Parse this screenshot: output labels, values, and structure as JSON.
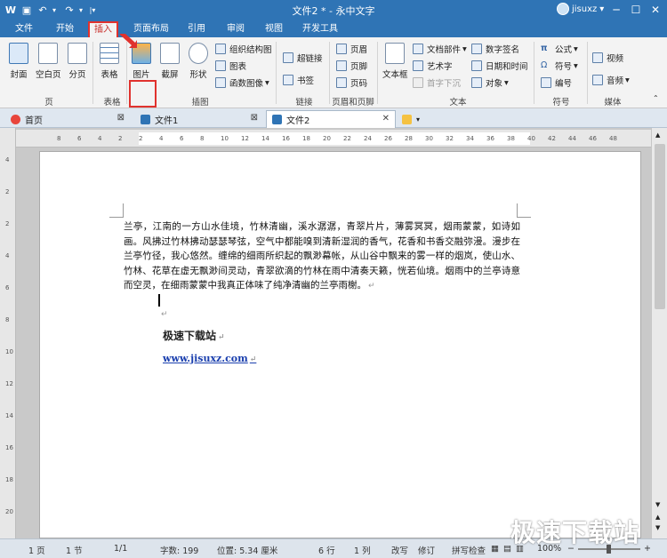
{
  "titlebar": {
    "title": "文件2 * - 永中文字",
    "username": "jisuxz"
  },
  "menu": [
    "文件",
    "开始",
    "插入",
    "页面布局",
    "引用",
    "审阅",
    "视图",
    "开发工具"
  ],
  "ribbon": {
    "page_group": {
      "cover": "封面",
      "blank": "空白页",
      "break": "分页",
      "label": "页"
    },
    "table_group": {
      "table": "表格",
      "label": "表格"
    },
    "illustration_group": {
      "picture": "图片",
      "screenshot": "截屏",
      "shape": "形状",
      "smartart": "组织结构图",
      "chart": "图表",
      "function": "函数图像",
      "label": "插图"
    },
    "link_group": {
      "hyperlink": "超链接",
      "bookmark": "书签",
      "label": "链接"
    },
    "header_group": {
      "header": "页眉",
      "footer": "页脚",
      "page_number": "页码",
      "label": "页眉和页脚"
    },
    "text_group": {
      "textbox": "文本框",
      "doc_parts": "文档部件",
      "art_text": "艺术字",
      "dropcap": "首字下沉",
      "digital_sig": "数字签名",
      "datetime": "日期和时间",
      "object": "对象",
      "label": "文本"
    },
    "symbol_group": {
      "formula": "公式",
      "symbol": "符号",
      "numbering": "编号",
      "label": "符号"
    },
    "media_group": {
      "video": "视频",
      "audio": "音频",
      "label": "媒体"
    }
  },
  "tabs": [
    {
      "label": "首页"
    },
    {
      "label": "文件1"
    },
    {
      "label": "文件2"
    }
  ],
  "ruler_numbers_h": [
    "8",
    "6",
    "4",
    "2",
    "2",
    "4",
    "6",
    "8",
    "10",
    "12",
    "14",
    "16",
    "18",
    "20",
    "22",
    "24",
    "26",
    "28",
    "30",
    "32",
    "34",
    "36",
    "38",
    "40",
    "42",
    "44",
    "46",
    "48"
  ],
  "ruler_numbers_v": [
    "4",
    "2",
    "2",
    "4",
    "6",
    "8",
    "10",
    "12",
    "14",
    "16",
    "18",
    "20"
  ],
  "document": {
    "paragraph": "兰亭，江南的一方山水佳境，竹林清幽，溪水潺潺，青翠片片，薄雾冥冥，烟雨蒙蒙，如诗如画。风拂过竹林拂动瑟瑟琴弦，空气中都能嗅到清新湿润的香气，花香和书香交融弥漫。漫步在兰亭竹径，我心悠然。缠绵的细雨所织起的飘渺幕帐，从山谷中飘来的雾一样的烟岚，使山水、竹林、花草在虚无飘渺间灵动，青翠欲滴的竹林在雨中清奏天籁，恍若仙境。烟雨中的兰亭诗意而空灵，在细雨蒙蒙中我真正体味了纯净清幽的兰亭雨榭。",
    "bold_line": "极速下载站",
    "link": "www.jisuxz.com",
    "para_mark": "↵"
  },
  "status": {
    "page": "1 页",
    "section": "1 节",
    "page_of": "1/1",
    "words": "字数: 199",
    "position": "位置: 5.34 厘米",
    "line": "6 行",
    "column": "1 列",
    "overwrite": "改写",
    "revise": "修订",
    "spellcheck": "拼写检查",
    "zoom": "100%"
  },
  "watermark": "极速下载站",
  "colors": {
    "title_blue": "#2f74b5",
    "highlight_red": "#e0322e",
    "link_blue": "#1a3fae"
  }
}
